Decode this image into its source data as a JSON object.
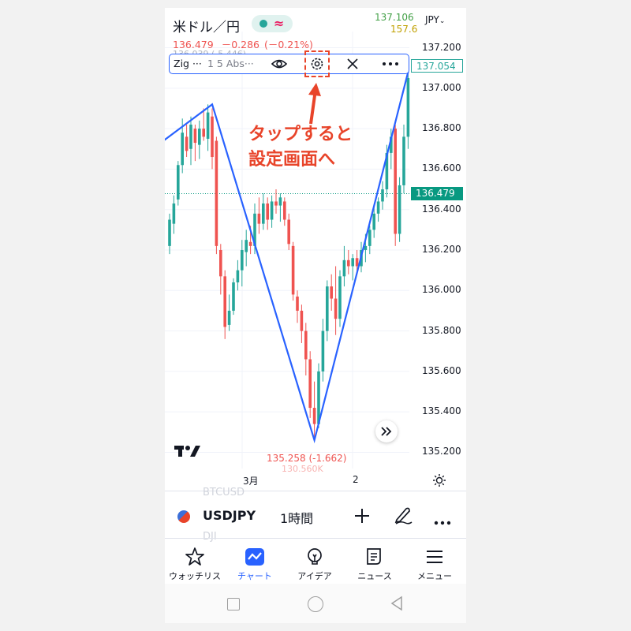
{
  "header": {
    "symbol_title": "米ドル／円",
    "approx_glyph": "≈",
    "price": "136.479",
    "change": "－0.286",
    "change_pct": "(－0.21%)",
    "faded_line": "136.039 (-5.446)",
    "top_right_price": "137.106",
    "top_right_price2": "157.6",
    "currency": "JPY"
  },
  "indicator_toolbar": {
    "name": "Zig ···",
    "params": "1 5 Abs···"
  },
  "annotation": {
    "line1": "タップすると",
    "line2": "設定画面へ"
  },
  "price_axis": {
    "labels": [
      "137.200",
      "137.000",
      "136.800",
      "136.600",
      "136.400",
      "136.200",
      "136.000",
      "135.800",
      "135.600",
      "135.400",
      "135.200"
    ],
    "highlight_price": "137.054",
    "current_price": "136.479"
  },
  "chart_labels": {
    "low_label": "135.258 (-1.662)",
    "low_sub": "130.560K",
    "month_label": "3月",
    "day_label": "2"
  },
  "chart_data": {
    "type": "candlestick",
    "series": [
      {
        "name": "USDJPY",
        "interval": "1時間"
      }
    ],
    "candles": [
      {
        "o": 136.22,
        "h": 136.38,
        "l": 136.18,
        "c": 136.35,
        "up": true
      },
      {
        "o": 136.33,
        "h": 136.47,
        "l": 136.28,
        "c": 136.43,
        "up": true
      },
      {
        "o": 136.45,
        "h": 136.64,
        "l": 136.42,
        "c": 136.62,
        "up": true
      },
      {
        "o": 136.62,
        "h": 136.85,
        "l": 136.58,
        "c": 136.78,
        "up": true
      },
      {
        "o": 136.76,
        "h": 136.82,
        "l": 136.66,
        "c": 136.69,
        "up": false
      },
      {
        "o": 136.7,
        "h": 136.86,
        "l": 136.62,
        "c": 136.82,
        "up": true
      },
      {
        "o": 136.8,
        "h": 136.82,
        "l": 136.64,
        "c": 136.73,
        "up": false
      },
      {
        "o": 136.72,
        "h": 136.84,
        "l": 136.65,
        "c": 136.8,
        "up": true
      },
      {
        "o": 136.8,
        "h": 136.9,
        "l": 136.74,
        "c": 136.76,
        "up": false
      },
      {
        "o": 136.75,
        "h": 136.92,
        "l": 136.69,
        "c": 136.88,
        "up": true
      },
      {
        "o": 136.86,
        "h": 136.9,
        "l": 136.6,
        "c": 136.66,
        "up": false
      },
      {
        "o": 136.74,
        "h": 136.76,
        "l": 136.18,
        "c": 136.22,
        "up": false
      },
      {
        "o": 136.2,
        "h": 136.23,
        "l": 135.98,
        "c": 136.07,
        "up": false
      },
      {
        "o": 136.07,
        "h": 136.1,
        "l": 135.76,
        "c": 135.82,
        "up": false
      },
      {
        "o": 135.83,
        "h": 135.98,
        "l": 135.8,
        "c": 135.9,
        "up": true
      },
      {
        "o": 135.9,
        "h": 136.06,
        "l": 135.88,
        "c": 136.04,
        "up": true
      },
      {
        "o": 136.04,
        "h": 136.15,
        "l": 136.0,
        "c": 136.1,
        "up": true
      },
      {
        "o": 136.1,
        "h": 136.25,
        "l": 136.02,
        "c": 136.2,
        "up": true
      },
      {
        "o": 136.19,
        "h": 136.3,
        "l": 136.12,
        "c": 136.25,
        "up": true
      },
      {
        "o": 136.24,
        "h": 136.32,
        "l": 136.18,
        "c": 136.22,
        "up": false
      },
      {
        "o": 136.22,
        "h": 136.43,
        "l": 136.18,
        "c": 136.38,
        "up": true
      },
      {
        "o": 136.38,
        "h": 136.46,
        "l": 136.28,
        "c": 136.33,
        "up": false
      },
      {
        "o": 136.33,
        "h": 136.48,
        "l": 136.3,
        "c": 136.43,
        "up": true
      },
      {
        "o": 136.43,
        "h": 136.46,
        "l": 136.3,
        "c": 136.35,
        "up": false
      },
      {
        "o": 136.35,
        "h": 136.47,
        "l": 136.31,
        "c": 136.44,
        "up": true
      },
      {
        "o": 136.44,
        "h": 136.5,
        "l": 136.38,
        "c": 136.42,
        "up": false
      },
      {
        "o": 136.42,
        "h": 136.48,
        "l": 136.34,
        "c": 136.46,
        "up": true
      },
      {
        "o": 136.44,
        "h": 136.46,
        "l": 136.32,
        "c": 136.35,
        "up": false
      },
      {
        "o": 136.35,
        "h": 136.38,
        "l": 136.2,
        "c": 136.23,
        "up": false
      },
      {
        "o": 136.22,
        "h": 136.24,
        "l": 135.95,
        "c": 135.98,
        "up": false
      },
      {
        "o": 135.97,
        "h": 136.0,
        "l": 135.84,
        "c": 135.9,
        "up": false
      },
      {
        "o": 135.9,
        "h": 135.93,
        "l": 135.74,
        "c": 135.8,
        "up": false
      },
      {
        "o": 135.8,
        "h": 135.84,
        "l": 135.58,
        "c": 135.66,
        "up": false
      },
      {
        "o": 135.66,
        "h": 135.7,
        "l": 135.37,
        "c": 135.42,
        "up": false
      },
      {
        "o": 135.42,
        "h": 135.55,
        "l": 135.26,
        "c": 135.34,
        "up": false
      },
      {
        "o": 135.34,
        "h": 135.64,
        "l": 135.32,
        "c": 135.6,
        "up": true
      },
      {
        "o": 135.6,
        "h": 135.86,
        "l": 135.55,
        "c": 135.8,
        "up": true
      },
      {
        "o": 135.8,
        "h": 136.05,
        "l": 135.75,
        "c": 136.02,
        "up": true
      },
      {
        "o": 136.02,
        "h": 136.08,
        "l": 135.9,
        "c": 135.96,
        "up": false
      },
      {
        "o": 135.96,
        "h": 136.12,
        "l": 135.78,
        "c": 135.86,
        "up": false
      },
      {
        "o": 135.86,
        "h": 136.1,
        "l": 135.82,
        "c": 136.07,
        "up": true
      },
      {
        "o": 136.07,
        "h": 136.22,
        "l": 136.02,
        "c": 136.15,
        "up": true
      },
      {
        "o": 136.15,
        "h": 136.2,
        "l": 136.08,
        "c": 136.12,
        "up": false
      },
      {
        "o": 136.12,
        "h": 136.18,
        "l": 136.05,
        "c": 136.16,
        "up": true
      },
      {
        "o": 136.16,
        "h": 136.2,
        "l": 136.08,
        "c": 136.12,
        "up": false
      },
      {
        "o": 136.12,
        "h": 136.24,
        "l": 136.09,
        "c": 136.2,
        "up": true
      },
      {
        "o": 136.2,
        "h": 136.28,
        "l": 136.14,
        "c": 136.22,
        "up": true
      },
      {
        "o": 136.22,
        "h": 136.32,
        "l": 136.18,
        "c": 136.3,
        "up": true
      },
      {
        "o": 136.3,
        "h": 136.42,
        "l": 136.26,
        "c": 136.38,
        "up": true
      },
      {
        "o": 136.38,
        "h": 136.46,
        "l": 136.34,
        "c": 136.44,
        "up": true
      },
      {
        "o": 136.44,
        "h": 136.54,
        "l": 136.4,
        "c": 136.5,
        "up": true
      },
      {
        "o": 136.5,
        "h": 136.72,
        "l": 136.46,
        "c": 136.68,
        "up": true
      },
      {
        "o": 136.68,
        "h": 136.8,
        "l": 136.6,
        "c": 136.76,
        "up": true
      },
      {
        "o": 136.8,
        "h": 136.82,
        "l": 136.22,
        "c": 136.28,
        "up": false
      },
      {
        "o": 136.28,
        "h": 136.56,
        "l": 136.24,
        "c": 136.52,
        "up": true
      },
      {
        "o": 136.52,
        "h": 136.82,
        "l": 136.48,
        "c": 136.76,
        "up": true
      },
      {
        "o": 136.76,
        "h": 137.08,
        "l": 136.7,
        "c": 137.05,
        "up": true
      }
    ],
    "zigzag": [
      {
        "i": -4,
        "p": 136.7
      },
      {
        "i": 10,
        "p": 136.92
      },
      {
        "i": 34,
        "p": 135.26
      },
      {
        "i": 56,
        "p": 137.08
      }
    ],
    "ylim": [
      135.12,
      137.28
    ]
  },
  "bottom_bar": {
    "ghost_top": "BTCUSD",
    "symbol": "USDJPY",
    "interval": "1時間",
    "ghost_bottom": "DJI"
  },
  "nav": {
    "items": [
      {
        "label": "ウォッチリスト",
        "icon": "star-icon"
      },
      {
        "label": "チャート",
        "icon": "chart-icon"
      },
      {
        "label": "アイデア",
        "icon": "lightbulb-icon"
      },
      {
        "label": "ニュース",
        "icon": "news-icon"
      },
      {
        "label": "メニュー",
        "icon": "menu-icon"
      }
    ]
  },
  "colors": {
    "up": "#26a69a",
    "down": "#ef5350",
    "zigzag": "#2962ff",
    "annotation": "#e8442a",
    "accent": "#2962ff"
  }
}
